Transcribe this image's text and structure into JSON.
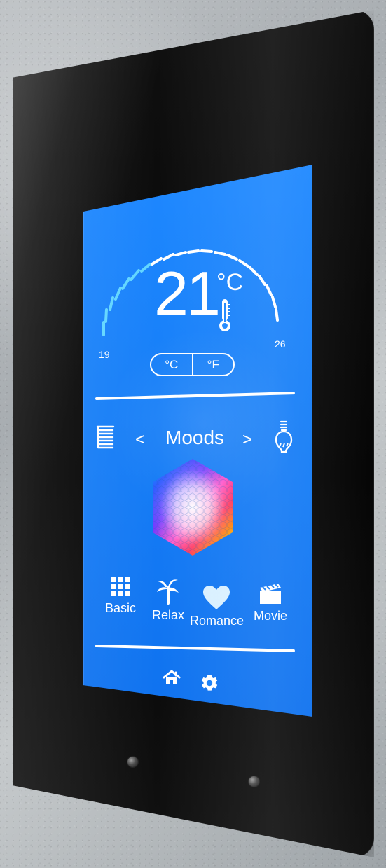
{
  "display": {
    "temperature": "21",
    "temperature_unit": "°C",
    "range_min": "19",
    "range_max": "26",
    "unit_toggle": [
      "°C",
      "°F"
    ]
  },
  "controls": {
    "prev_symbol": "<",
    "next_symbol": ">",
    "mode_title": "Moods"
  },
  "presets": [
    {
      "label": "Basic",
      "icon": "grid-icon"
    },
    {
      "label": "Relax",
      "icon": "palm-tree-icon"
    },
    {
      "label": "Romance",
      "icon": "heart-icon"
    },
    {
      "label": "Movie",
      "icon": "clapperboard-icon"
    }
  ],
  "bottom_nav": [
    "home-icon",
    "gear-icon"
  ],
  "colors": {
    "screen_blue": "#167ef7",
    "device_black": "#080808",
    "dial_cool": "#66d4ff",
    "dial_warm": "#ffffff"
  }
}
